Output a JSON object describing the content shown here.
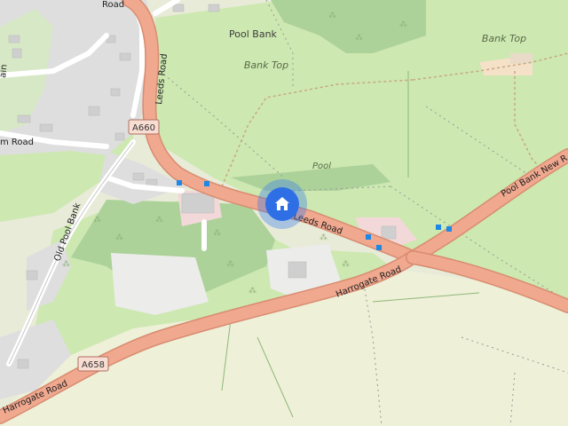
{
  "map": {
    "places": {
      "pool_bank": "Pool Bank",
      "bank_top_italic": "Bank Top",
      "bank_top_small": "Bank Top",
      "pool": "Pool"
    },
    "roads": {
      "leeds_road_1": "Leeds Road",
      "leeds_road_2": "Leeds Road",
      "harrogate_road_1": "Harrogate Road",
      "harrogate_road_2": "Harrogate Road",
      "old_pool_bank": "Old Pool Bank",
      "pool_bank_new_road": "Pool Bank New R",
      "m_road": "m Road",
      "top_road": "Road",
      "lane_left": "ain"
    },
    "shields": {
      "a660": "A660",
      "a658": "A658"
    },
    "colors": {
      "main_road": "#f0a88f",
      "field": "#cde8b0",
      "woods": "#acd29a",
      "residential": "#dedede",
      "location_marker": "#2f6fe6"
    },
    "controls": {
      "home_icon": "home-icon"
    }
  }
}
